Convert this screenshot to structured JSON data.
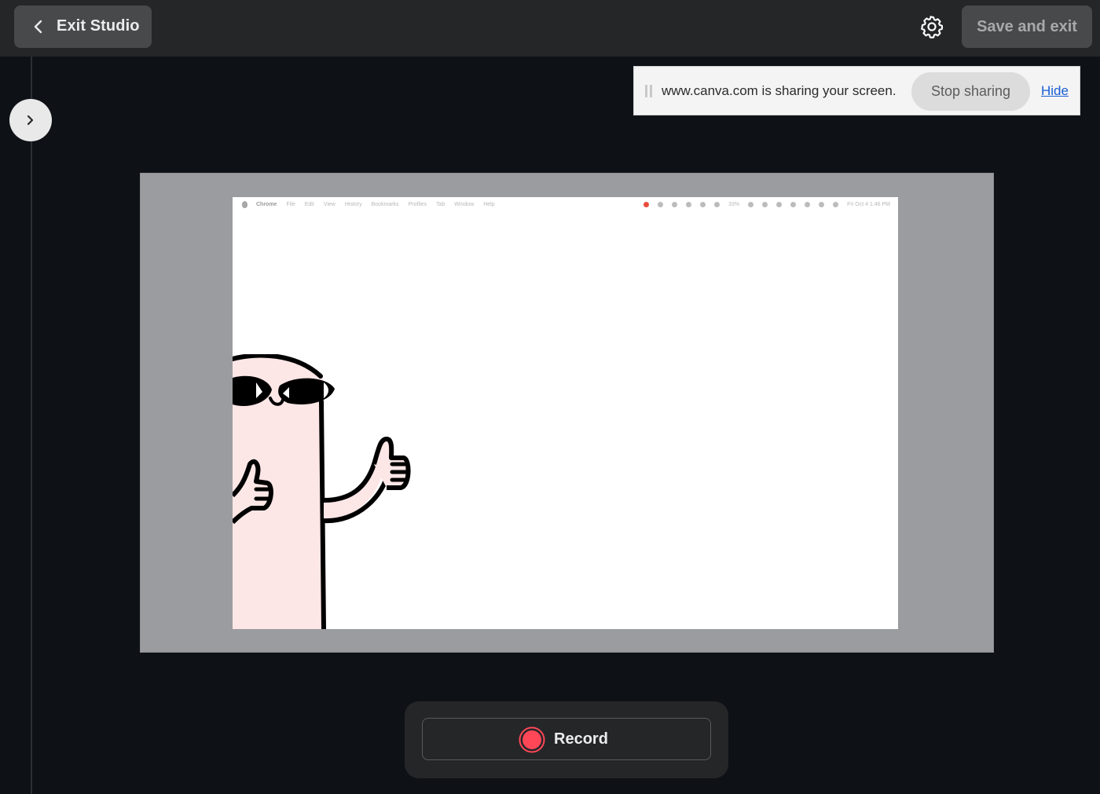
{
  "topbar": {
    "exit_label": "Exit Studio",
    "save_label": "Save and exit",
    "icons": {
      "back": "chevron-left-icon",
      "settings": "gear-icon"
    }
  },
  "sidebar": {
    "expand_icon": "chevron-right-icon"
  },
  "share_notification": {
    "message": "www.canva.com is sharing your screen.",
    "stop_label": "Stop sharing",
    "hide_label": "Hide"
  },
  "shared_screen": {
    "menubar": {
      "app": "Chrome",
      "items": [
        "File",
        "Edit",
        "View",
        "History",
        "Bookmarks",
        "Profiles",
        "Tab",
        "Window",
        "Help"
      ],
      "battery": "33%",
      "datetime": "Fri Oct 4  1:46 PM"
    },
    "illustration": "pink character with sunglasses giving thumbs up"
  },
  "recorder": {
    "record_label": "Record",
    "record_color": "#ff4757"
  },
  "colors": {
    "background": "#0e1216",
    "topbar": "#252628",
    "button": "#48494b",
    "stage": "#9a9ca0",
    "link": "#1a5fd4"
  }
}
